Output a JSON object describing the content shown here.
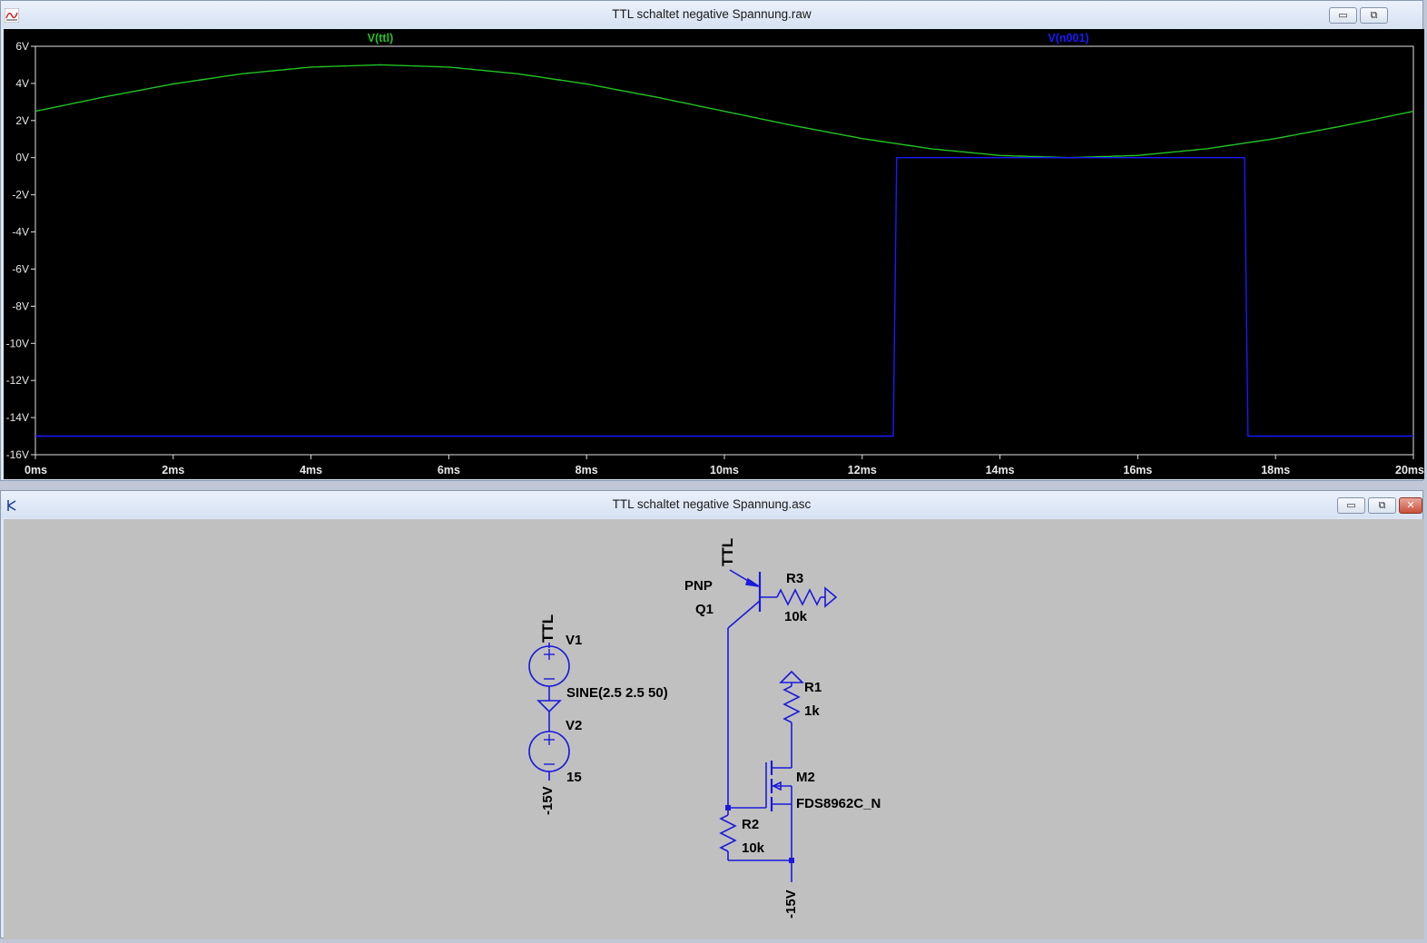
{
  "plot_window": {
    "title": "TTL schaltet negative Spannung.raw",
    "icon": "waveform-icon",
    "controls": {
      "minimize": "▭",
      "restore": "⧉"
    }
  },
  "schematic_window": {
    "title": "TTL schaltet negative Spannung.asc",
    "icon": "schematic-icon",
    "controls": {
      "minimize": "▭",
      "restore": "⧉",
      "close": "✕"
    }
  },
  "chart_data": {
    "type": "line",
    "title": "",
    "xlabel": "",
    "ylabel": "",
    "xlim": [
      0,
      20
    ],
    "ylim": [
      -16,
      6
    ],
    "x_ticks": [
      "0ms",
      "2ms",
      "4ms",
      "6ms",
      "8ms",
      "10ms",
      "12ms",
      "14ms",
      "16ms",
      "18ms",
      "20ms"
    ],
    "y_ticks": [
      "6V",
      "4V",
      "2V",
      "0V",
      "-2V",
      "-4V",
      "-6V",
      "-8V",
      "-10V",
      "-12V",
      "-14V",
      "-16V"
    ],
    "grid": false,
    "background": "#000000",
    "series": [
      {
        "name": "V(ttl)",
        "color": "#22c322",
        "x": [
          0,
          1,
          2,
          3,
          4,
          5,
          6,
          7,
          8,
          9,
          10,
          11,
          12,
          13,
          14,
          15,
          16,
          17,
          18,
          19,
          20
        ],
        "y": [
          2.5,
          3.27,
          3.97,
          4.52,
          4.88,
          5.0,
          4.88,
          4.52,
          3.97,
          3.27,
          2.5,
          1.73,
          1.03,
          0.48,
          0.12,
          0.0,
          0.12,
          0.48,
          1.03,
          1.73,
          2.5
        ]
      },
      {
        "name": "V(n001)",
        "color": "#1a1aff",
        "x": [
          0,
          12.45,
          12.5,
          14.5,
          15.5,
          17.55,
          17.6,
          20
        ],
        "y": [
          -15,
          -15,
          0,
          0,
          0,
          0,
          -15,
          -15
        ]
      }
    ]
  },
  "schematic": {
    "labels": {
      "ttl_q1": "TTL",
      "pnp": "PNP",
      "q1": "Q1",
      "r3": "R3",
      "r3_val": "10k",
      "ttl_v1": "TTL",
      "v1": "V1",
      "sine": "SINE(2.5 2.5 50)",
      "v2": "V2",
      "v2_val": "15",
      "neg15_v2": "-15V",
      "r1": "R1",
      "r1_val": "1k",
      "m2": "M2",
      "m2_model": "FDS8962C_N",
      "r2": "R2",
      "r2_val": "10k",
      "neg15_bottom": "-15V"
    },
    "wire_color": "#1a1adc",
    "text_color": "#000000"
  }
}
